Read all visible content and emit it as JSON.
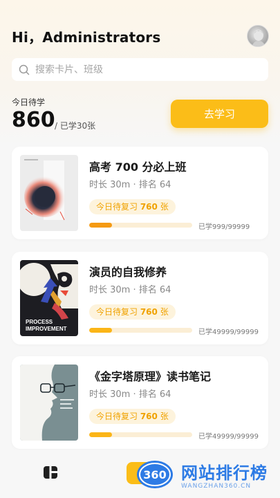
{
  "header": {
    "greeting": "Hi，Administrators"
  },
  "search": {
    "placeholder": "搜索卡片、班级"
  },
  "today": {
    "label": "今日待学",
    "count": "860",
    "learned": "/ 已学30张",
    "button_label": "去学习"
  },
  "courses": [
    {
      "title": "高考 700 分必上班",
      "meta": "时长 30m · 排名 64",
      "review_prefix": "今日待复习 ",
      "review_count": "760",
      "review_suffix": " 张",
      "progress_text": "已学999/99999",
      "progress": 0.22,
      "progress_color": "#f59a12",
      "cover": "abstract-gradient-poster"
    },
    {
      "title": "演员的自我修养",
      "meta": "时长 30m · 排名 64",
      "review_prefix": "今日待复习 ",
      "review_count": "760",
      "review_suffix": " 张",
      "progress_text": "已学49999/99999",
      "progress": 0.22,
      "progress_color": "#fbb517",
      "cover": "process-improvement-poster",
      "cover_text_1": "PROCESS",
      "cover_text_2": "IMPROVEMENT"
    },
    {
      "title": "《金字塔原理》读书笔记",
      "meta": "时长 30m · 排名 64",
      "review_prefix": "今日待复习 ",
      "review_count": "760",
      "review_suffix": " 张",
      "progress_text": "已学49999/99999",
      "progress": 0.22,
      "progress_color": "#fbb517",
      "cover": "face-profile-poster"
    }
  ],
  "watermark": {
    "logo_text": "360",
    "title": "网站排行榜",
    "subtitle": "WANGZHAN360.CN"
  },
  "colors": {
    "accent": "#fbbd18",
    "badge_bg": "#fdf3dc",
    "badge_text": "#f0a200"
  },
  "icons": {
    "search": "search-icon",
    "tab_home": "cards-icon"
  }
}
